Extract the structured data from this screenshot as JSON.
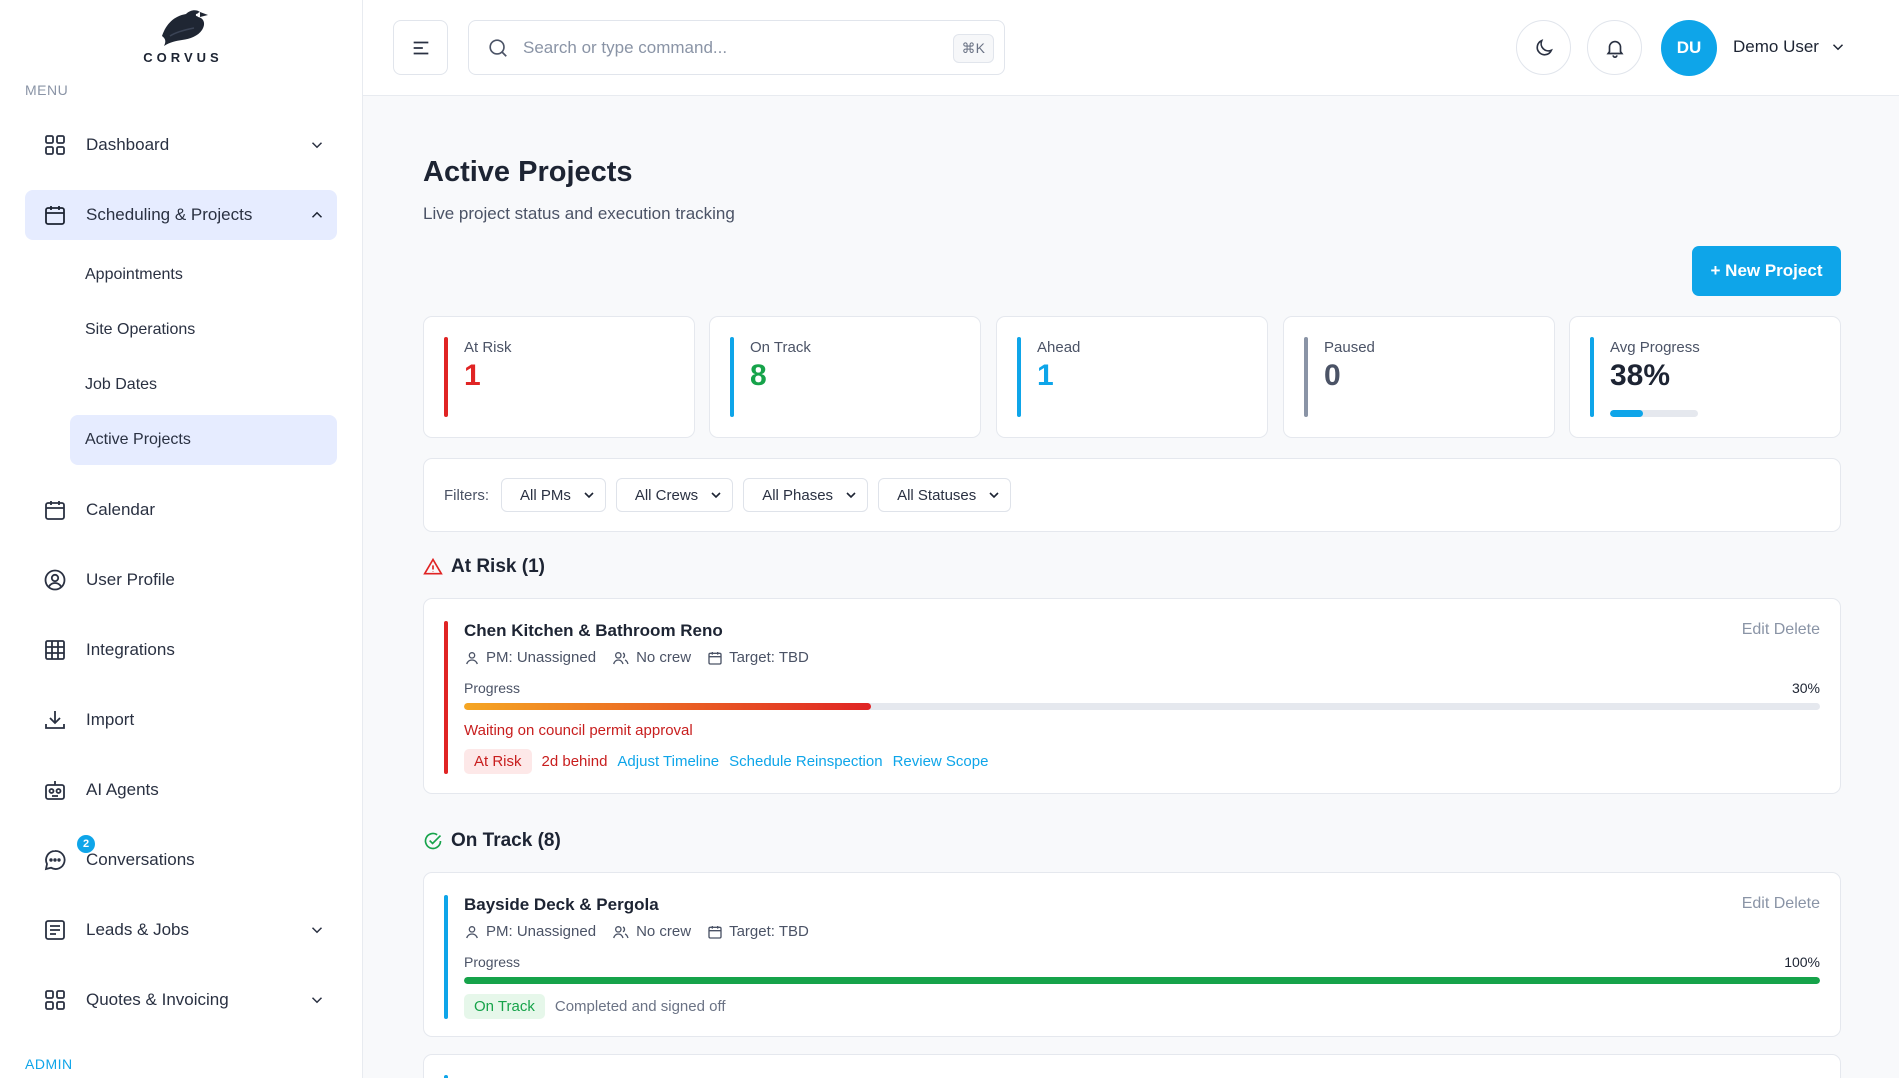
{
  "brand": {
    "name": "CORVUS"
  },
  "sidebar": {
    "menu_label": "MENU",
    "admin_label": "ADMIN",
    "items": [
      {
        "label": "Dashboard"
      },
      {
        "label": "Scheduling & Projects"
      },
      {
        "label": "Calendar"
      },
      {
        "label": "User Profile"
      },
      {
        "label": "Integrations"
      },
      {
        "label": "Import"
      },
      {
        "label": "AI Agents"
      },
      {
        "label": "Conversations",
        "badge": "2"
      },
      {
        "label": "Leads & Jobs"
      },
      {
        "label": "Quotes & Invoicing"
      }
    ],
    "sub_items": [
      {
        "label": "Appointments"
      },
      {
        "label": "Site Operations"
      },
      {
        "label": "Job Dates"
      },
      {
        "label": "Active Projects"
      }
    ]
  },
  "header": {
    "search_placeholder": "Search or type command...",
    "shortcut": "⌘K",
    "avatar_initials": "DU",
    "user_name": "Demo User"
  },
  "page": {
    "title": "Active Projects",
    "subtitle": "Live project status and execution tracking",
    "new_button": "+ New Project"
  },
  "stats": [
    {
      "label": "At Risk",
      "value": "1",
      "color": "#e02424"
    },
    {
      "label": "On Track",
      "value": "8",
      "color": "#16a34a"
    },
    {
      "label": "Ahead",
      "value": "1",
      "color": "#0ea5e9"
    },
    {
      "label": "Paused",
      "value": "0",
      "color": "#4b5366"
    },
    {
      "label": "Avg Progress",
      "value": "38%",
      "color": "#1d2433",
      "progress": 0.38
    }
  ],
  "filters": {
    "label": "Filters:",
    "selects": [
      "All PMs",
      "All Crews",
      "All Phases",
      "All Statuses"
    ]
  },
  "sections": {
    "at_risk": "At Risk (1)",
    "on_track": "On Track (8)"
  },
  "projects": [
    {
      "name": "Chen Kitchen & Bathroom Reno",
      "edit": "Edit",
      "delete": "Delete",
      "pm": "PM: Unassigned",
      "crew": "No crew",
      "target": "Target: TBD",
      "progress_label": "Progress",
      "progress_text": "30%",
      "progress": 0.3,
      "note": "Waiting on council permit approval",
      "status": "At Risk",
      "behind": "2d behind",
      "links": [
        "Adjust Timeline",
        "Schedule Reinspection",
        "Review Scope"
      ]
    },
    {
      "name": "Bayside Deck & Pergola",
      "edit": "Edit",
      "delete": "Delete",
      "pm": "PM: Unassigned",
      "crew": "No crew",
      "target": "Target: TBD",
      "progress_label": "Progress",
      "progress_text": "100%",
      "progress": 1.0,
      "status": "On Track",
      "status_note": "Completed and signed off"
    }
  ],
  "colors": {
    "accent": "#0ea5e9",
    "risk": "#e02424",
    "track": "#16a34a"
  }
}
